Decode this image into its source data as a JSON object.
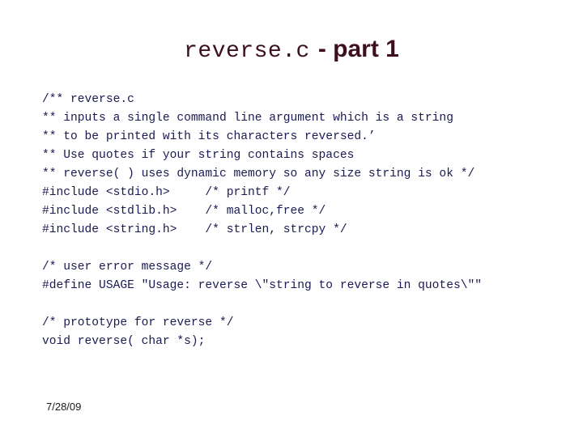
{
  "slide": {
    "title": {
      "mono_part": "reverse.c",
      "sans_part": "- part 1"
    },
    "code_lines": [
      "/** reverse.c",
      "** inputs a single command line argument which is a string",
      "** to be printed with its characters reversed.’",
      "** Use quotes if your string contains spaces",
      "** reverse( ) uses dynamic memory so any size string is ok */",
      "#include <stdio.h>     /* printf */",
      "#include <stdlib.h>    /* malloc,free */",
      "#include <string.h>    /* strlen, strcpy */",
      "",
      "/* user error message */",
      "#define USAGE \"Usage: reverse \\\"string to reverse in quotes\\\"\"",
      "",
      "/* prototype for reverse */",
      "void reverse( char *s);"
    ],
    "footer": {
      "date": "7/28/09"
    },
    "colors": {
      "title": "#3d1020",
      "code": "#1a1a52",
      "footer": "#1a1a1a",
      "background": "#ffffff"
    }
  }
}
